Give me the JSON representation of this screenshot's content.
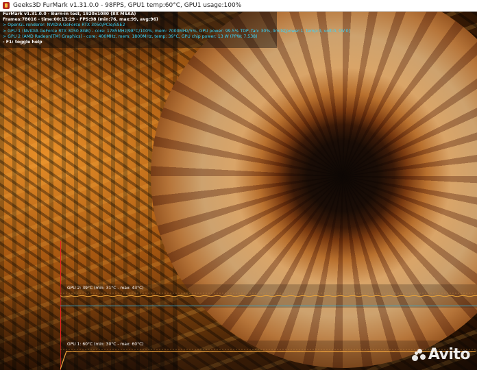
{
  "window": {
    "title": "Geeks3D FurMark v1.31.0.0 - 98FPS, GPU1 temp:60°C, GPU1 usage:100%"
  },
  "hud": {
    "lines": [
      "FurMark v1.31.0.0 - Burn-in test, 1920x1080 (8X MSAA)",
      "Frames:78016 - time:00:13:29 - FPS:98 (min:76, max:99, avg:96)",
      "> OpenGL renderer: NVIDIA GeForce RTX 3050/PCIe/SSE2",
      "> GPU 1 (NVIDIA GeForce RTX 3050 8GB) - core: 1785MHz/98°C/100%, mem: 7000MHz/5%, GPU power: 99.5% TDP, fan: 30%, limits[power:1, temp:0, volt:0, OV:0]",
      "> GPU 2 (AMD Radeon(TM) Graphics) - core: 400MHz, mem: 1800MHz, temp: 39°C, GPU chip power: 13 W (PPW: 7.538)",
      "- F1: toggle help"
    ]
  },
  "graphs": {
    "gpu2": {
      "label": "GPU 2: 39°C (min: 31°C - max: 43°C)",
      "current_c": 39,
      "min_c": 31,
      "max_c": 43,
      "color": "#e8a23a"
    },
    "gpu1": {
      "label": "GPU 1: 60°C (min: 30°C - max: 60°C)",
      "current_c": 60,
      "min_c": 30,
      "max_c": 60,
      "color": "#f2a53d"
    }
  },
  "watermark": {
    "text": "Avito"
  },
  "colors": {
    "hud_white": "#ffffff",
    "hud_cyan": "#35d7ff",
    "marker_red": "#e82020"
  },
  "icons": {
    "app": "furmark-icon",
    "watermark": "avito-logo"
  }
}
